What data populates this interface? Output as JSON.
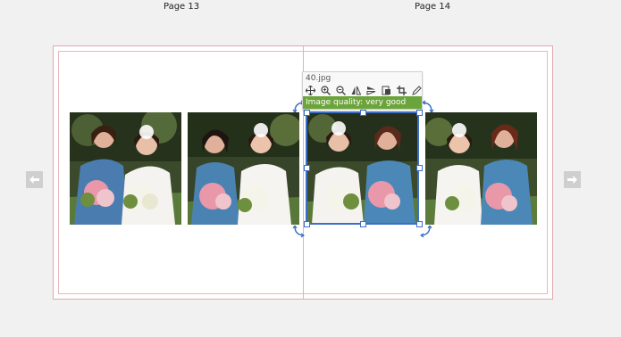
{
  "pages": {
    "left_label": "Page 13",
    "right_label": "Page 14"
  },
  "selected_photo": {
    "filename": "40.jpg",
    "quality_text": "Image quality: very good"
  },
  "toolbar_icons": [
    "move-icon",
    "zoom-in-icon",
    "zoom-out-icon",
    "flip-horizontal-icon",
    "flip-vertical-icon",
    "fit-page-icon",
    "crop-icon",
    "edit-icon"
  ],
  "colors": {
    "selection": "#3b6ec8",
    "quality_bar": "#6ba43a",
    "page_border": "#e0a8ad"
  }
}
